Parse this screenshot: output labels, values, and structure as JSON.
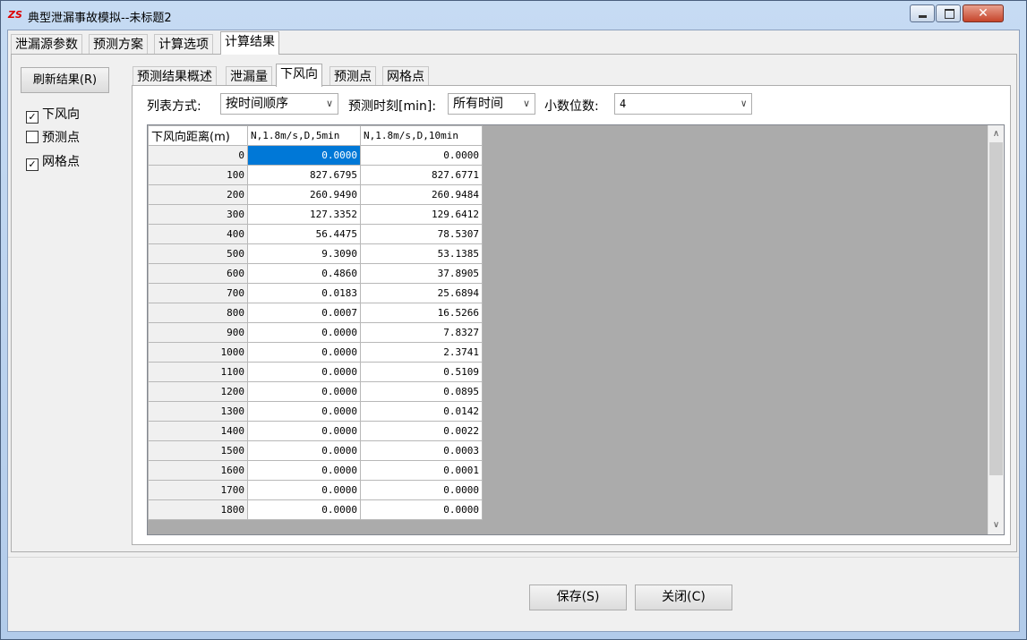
{
  "window": {
    "icon_text": "ZS",
    "title": "典型泄漏事故模拟--未标题2",
    "minimize_icon": "minimize-icon",
    "maximize_icon": "maximize-icon",
    "close_icon": "close-icon",
    "close_glyph": "✕"
  },
  "main_tabs": [
    "泄漏源参数",
    "预测方案",
    "计算选项",
    "计算结果"
  ],
  "left_panel": {
    "refresh_label": "刷新结果(R)",
    "checkboxes": [
      {
        "label": "下风向",
        "checked": true,
        "mark": "✓"
      },
      {
        "label": "预测点",
        "checked": false,
        "mark": ""
      },
      {
        "label": "网格点",
        "checked": true,
        "mark": "✓"
      }
    ]
  },
  "sub_tabs": [
    "预测结果概述",
    "泄漏量",
    "下风向",
    "预测点",
    "网格点"
  ],
  "controls": {
    "list_mode_label": "列表方式:",
    "list_mode_value": "按时间顺序",
    "time_label": "预测时刻[min]:",
    "time_value": "所有时间",
    "decimals_label": "小数位数:",
    "decimals_value": "4",
    "dropdown_arrow": "∨"
  },
  "grid": {
    "headers": [
      "下风向距离(m)",
      "N,1.8m/s,D,5min",
      "N,1.8m/s,D,10min"
    ],
    "rows": [
      [
        "0",
        "0.0000",
        "0.0000"
      ],
      [
        "100",
        "827.6795",
        "827.6771"
      ],
      [
        "200",
        "260.9490",
        "260.9484"
      ],
      [
        "300",
        "127.3352",
        "129.6412"
      ],
      [
        "400",
        "56.4475",
        "78.5307"
      ],
      [
        "500",
        "9.3090",
        "53.1385"
      ],
      [
        "600",
        "0.4860",
        "37.8905"
      ],
      [
        "700",
        "0.0183",
        "25.6894"
      ],
      [
        "800",
        "0.0007",
        "16.5266"
      ],
      [
        "900",
        "0.0000",
        "7.8327"
      ],
      [
        "1000",
        "0.0000",
        "2.3741"
      ],
      [
        "1100",
        "0.0000",
        "0.5109"
      ],
      [
        "1200",
        "0.0000",
        "0.0895"
      ],
      [
        "1300",
        "0.0000",
        "0.0142"
      ],
      [
        "1400",
        "0.0000",
        "0.0022"
      ],
      [
        "1500",
        "0.0000",
        "0.0003"
      ],
      [
        "1600",
        "0.0000",
        "0.0001"
      ],
      [
        "1700",
        "0.0000",
        "0.0000"
      ],
      [
        "1800",
        "0.0000",
        "0.0000"
      ]
    ],
    "scroll_up": "∧",
    "scroll_down": "∨"
  },
  "buttons": {
    "save_label": "保存(S)",
    "close_label": "关闭(C)"
  },
  "colors": {
    "selection": "#0078d7",
    "close_button": "#c6442a",
    "grid_empty": "#ababab"
  }
}
